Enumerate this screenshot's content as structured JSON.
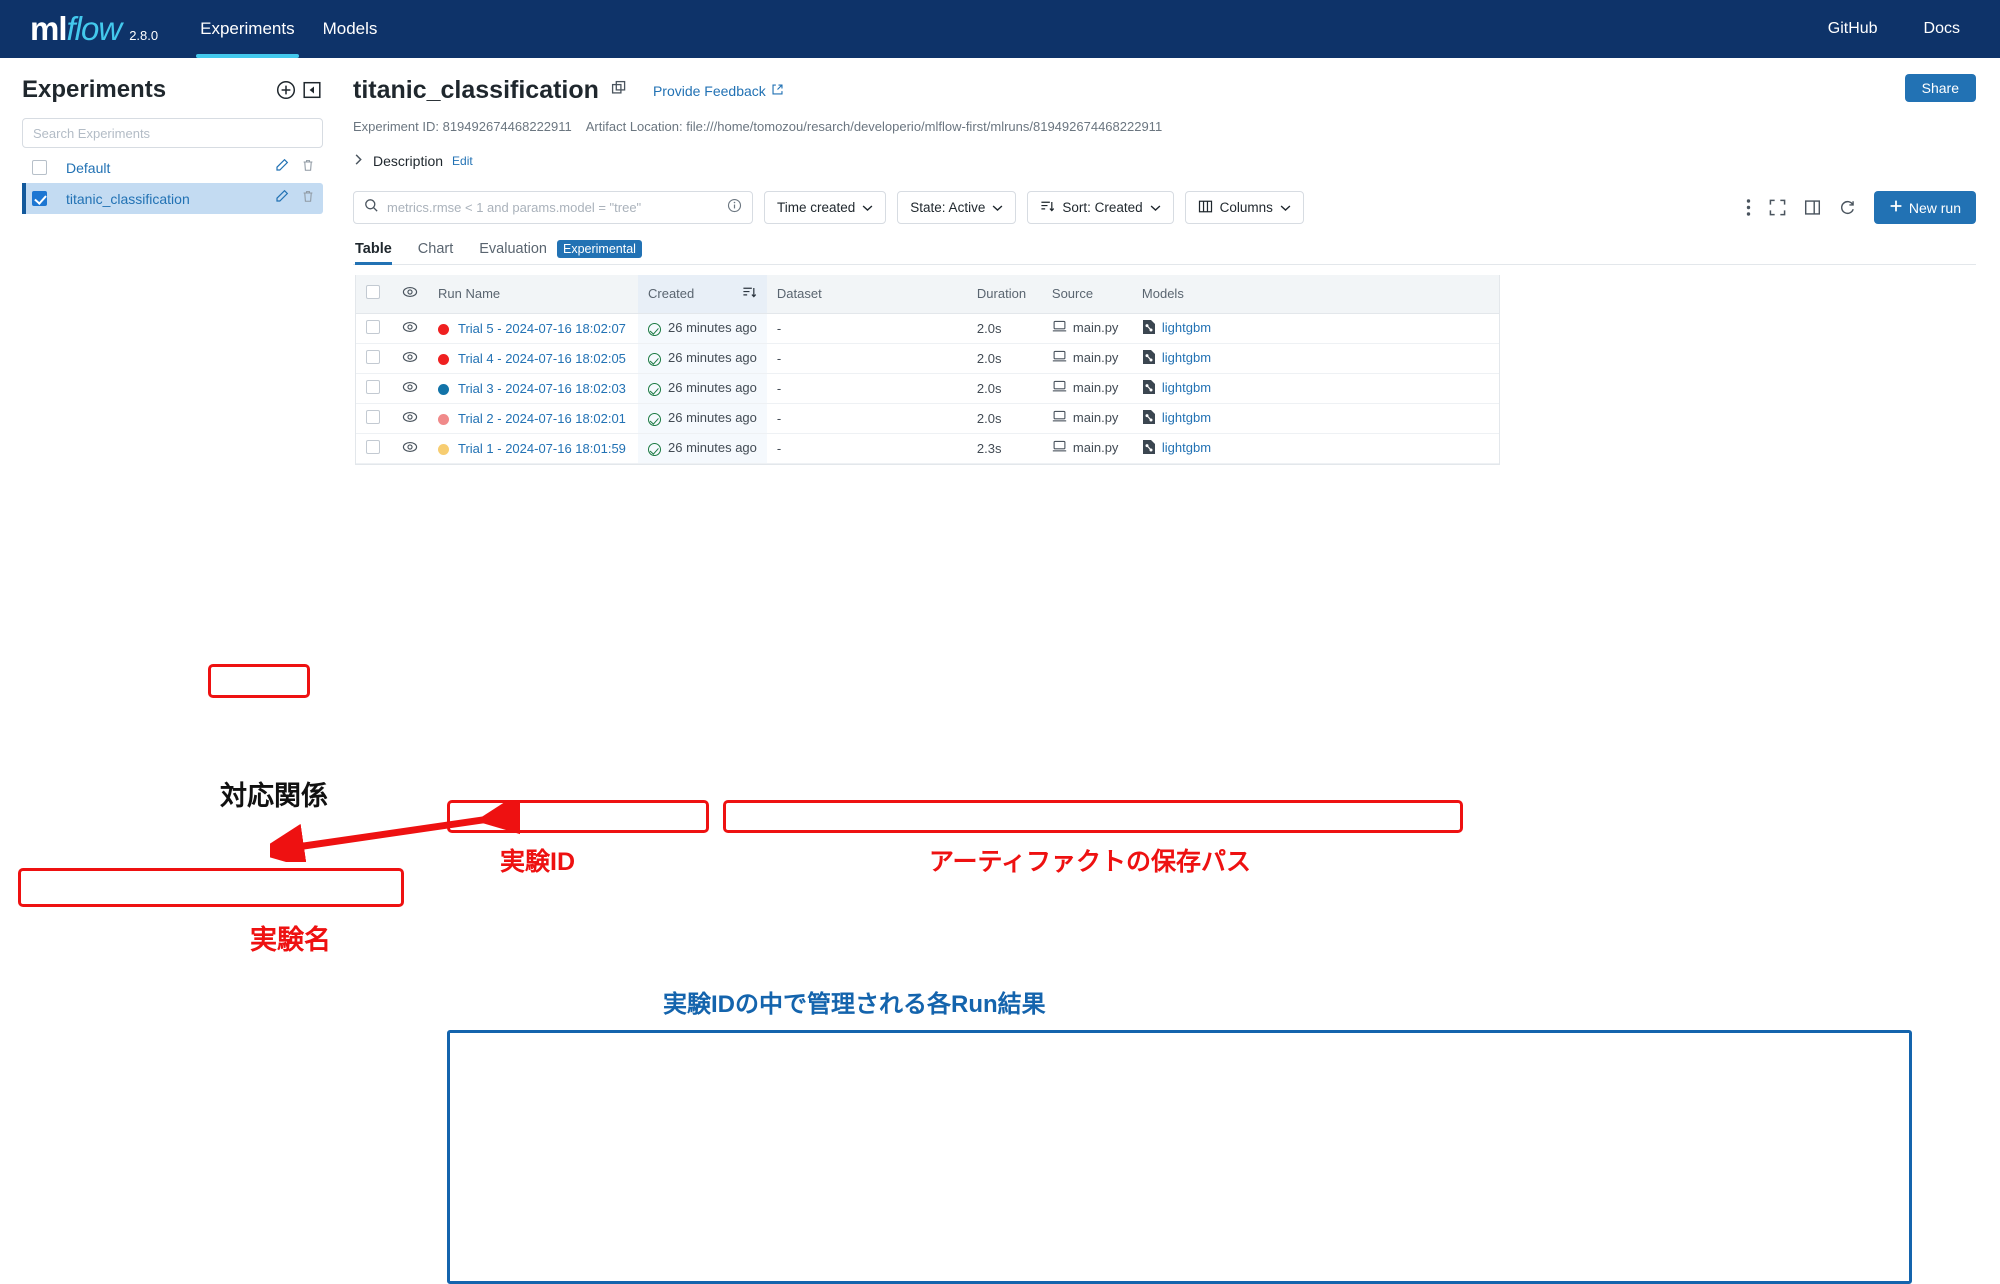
{
  "topnav": {
    "logo_ml": "ml",
    "logo_flow": "flow",
    "version": "2.8.0",
    "items": [
      {
        "label": "Experiments",
        "active": true
      },
      {
        "label": "Models",
        "active": false
      }
    ],
    "right_links": [
      {
        "label": "GitHub"
      },
      {
        "label": "Docs"
      }
    ]
  },
  "sidebar": {
    "title": "Experiments",
    "new_experiment_icon": "plus-circle-icon",
    "collapse_icon": "collapse-panel-icon",
    "search_placeholder": "Search Experiments",
    "items": [
      {
        "label": "Default",
        "checked": false
      },
      {
        "label": "titanic_classification",
        "checked": true
      }
    ],
    "row_actions": {
      "edit": "pencil-icon",
      "delete": "trash-icon"
    }
  },
  "main": {
    "title": "titanic_classification",
    "copy_icon": "copy-icon",
    "feedback_label": "Provide Feedback",
    "feedback_icon": "external-link-icon",
    "share_label": "Share",
    "experiment_id": "Experiment ID: 819492674468222911",
    "artifact_location": "Artifact Location: file:///home/tomozou/resarch/developerio/mlflow-first/mlruns/819492674468222911",
    "description_label": "Description",
    "description_edit": "Edit",
    "description_chevron": "chevron-right-icon"
  },
  "toolbar": {
    "search_placeholder": "metrics.rmse < 1 and params.model = \"tree\"",
    "search_icon": "search-icon",
    "info_icon": "info-circle-icon",
    "time_created_label": "Time created",
    "state_label": "State: Active",
    "sort_label": "Sort: Created",
    "columns_label": "Columns",
    "overflow_icon": "kebab-menu-icon",
    "fullscreen_icon": "expand-icon",
    "sidepanel_icon": "toggle-sidepanel-icon",
    "refresh_icon": "refresh-icon",
    "new_run_label": "New run",
    "new_run_icon": "plus-icon"
  },
  "tabs": [
    {
      "label": "Table",
      "active": true
    },
    {
      "label": "Chart",
      "active": false
    },
    {
      "label": "Evaluation",
      "active": false,
      "badge": "Experimental"
    }
  ],
  "table": {
    "columns": [
      "",
      "",
      "Run Name",
      "Created",
      "Dataset",
      "Duration",
      "Source",
      "Models"
    ],
    "sort_icon": "sort-desc-icon",
    "visibility_icon": "eye-icon",
    "source_icon": "laptop-icon",
    "model_icon": "model-file-icon",
    "status_icon": "check-circle-icon",
    "rows": [
      {
        "color": "#ef2020",
        "run_name": "Trial 5 - 2024-07-16 18:02:07",
        "created": "26 minutes ago",
        "dataset": "-",
        "duration": "2.0s",
        "source": "main.py",
        "model": "lightgbm"
      },
      {
        "color": "#ef2020",
        "run_name": "Trial 4 - 2024-07-16 18:02:05",
        "created": "26 minutes ago",
        "dataset": "-",
        "duration": "2.0s",
        "source": "main.py",
        "model": "lightgbm"
      },
      {
        "color": "#1273a8",
        "run_name": "Trial 3 - 2024-07-16 18:02:03",
        "created": "26 minutes ago",
        "dataset": "-",
        "duration": "2.0s",
        "source": "main.py",
        "model": "lightgbm"
      },
      {
        "color": "#f08a8a",
        "run_name": "Trial 2 - 2024-07-16 18:02:01",
        "created": "26 minutes ago",
        "dataset": "-",
        "duration": "2.0s",
        "source": "main.py",
        "model": "lightgbm"
      },
      {
        "color": "#f7cd71",
        "run_name": "Trial 1 - 2024-07-16 18:01:59",
        "created": "26 minutes ago",
        "dataset": "-",
        "duration": "2.3s",
        "source": "main.py",
        "model": "lightgbm"
      }
    ]
  },
  "annotations": {
    "correspondence": "対応関係",
    "experiment_name": "実験名",
    "experiment_id": "実験ID",
    "artifact_path": "アーティファクトの保存パス",
    "runs_caption": "実験IDの中で管理される各Run結果",
    "accent_red": "#ee1111",
    "accent_blue": "#1464ad"
  }
}
